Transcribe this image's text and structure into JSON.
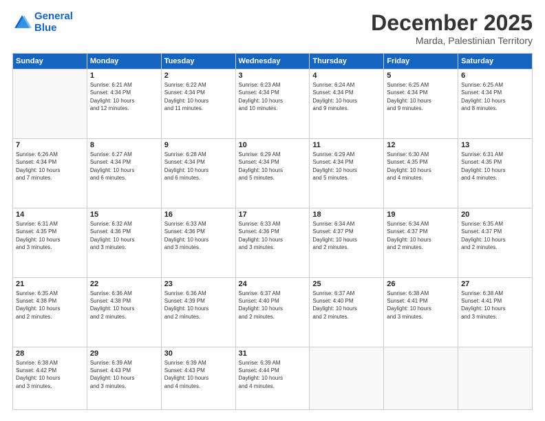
{
  "logo": {
    "line1": "General",
    "line2": "Blue"
  },
  "title": "December 2025",
  "location": "Marda, Palestinian Territory",
  "days_of_week": [
    "Sunday",
    "Monday",
    "Tuesday",
    "Wednesday",
    "Thursday",
    "Friday",
    "Saturday"
  ],
  "weeks": [
    [
      {
        "num": "",
        "info": ""
      },
      {
        "num": "1",
        "info": "Sunrise: 6:21 AM\nSunset: 4:34 PM\nDaylight: 10 hours\nand 12 minutes."
      },
      {
        "num": "2",
        "info": "Sunrise: 6:22 AM\nSunset: 4:34 PM\nDaylight: 10 hours\nand 11 minutes."
      },
      {
        "num": "3",
        "info": "Sunrise: 6:23 AM\nSunset: 4:34 PM\nDaylight: 10 hours\nand 10 minutes."
      },
      {
        "num": "4",
        "info": "Sunrise: 6:24 AM\nSunset: 4:34 PM\nDaylight: 10 hours\nand 9 minutes."
      },
      {
        "num": "5",
        "info": "Sunrise: 6:25 AM\nSunset: 4:34 PM\nDaylight: 10 hours\nand 9 minutes."
      },
      {
        "num": "6",
        "info": "Sunrise: 6:25 AM\nSunset: 4:34 PM\nDaylight: 10 hours\nand 8 minutes."
      }
    ],
    [
      {
        "num": "7",
        "info": "Sunrise: 6:26 AM\nSunset: 4:34 PM\nDaylight: 10 hours\nand 7 minutes."
      },
      {
        "num": "8",
        "info": "Sunrise: 6:27 AM\nSunset: 4:34 PM\nDaylight: 10 hours\nand 6 minutes."
      },
      {
        "num": "9",
        "info": "Sunrise: 6:28 AM\nSunset: 4:34 PM\nDaylight: 10 hours\nand 6 minutes."
      },
      {
        "num": "10",
        "info": "Sunrise: 6:29 AM\nSunset: 4:34 PM\nDaylight: 10 hours\nand 5 minutes."
      },
      {
        "num": "11",
        "info": "Sunrise: 6:29 AM\nSunset: 4:34 PM\nDaylight: 10 hours\nand 5 minutes."
      },
      {
        "num": "12",
        "info": "Sunrise: 6:30 AM\nSunset: 4:35 PM\nDaylight: 10 hours\nand 4 minutes."
      },
      {
        "num": "13",
        "info": "Sunrise: 6:31 AM\nSunset: 4:35 PM\nDaylight: 10 hours\nand 4 minutes."
      }
    ],
    [
      {
        "num": "14",
        "info": "Sunrise: 6:31 AM\nSunset: 4:35 PM\nDaylight: 10 hours\nand 3 minutes."
      },
      {
        "num": "15",
        "info": "Sunrise: 6:32 AM\nSunset: 4:36 PM\nDaylight: 10 hours\nand 3 minutes."
      },
      {
        "num": "16",
        "info": "Sunrise: 6:33 AM\nSunset: 4:36 PM\nDaylight: 10 hours\nand 3 minutes."
      },
      {
        "num": "17",
        "info": "Sunrise: 6:33 AM\nSunset: 4:36 PM\nDaylight: 10 hours\nand 3 minutes."
      },
      {
        "num": "18",
        "info": "Sunrise: 6:34 AM\nSunset: 4:37 PM\nDaylight: 10 hours\nand 2 minutes."
      },
      {
        "num": "19",
        "info": "Sunrise: 6:34 AM\nSunset: 4:37 PM\nDaylight: 10 hours\nand 2 minutes."
      },
      {
        "num": "20",
        "info": "Sunrise: 6:35 AM\nSunset: 4:37 PM\nDaylight: 10 hours\nand 2 minutes."
      }
    ],
    [
      {
        "num": "21",
        "info": "Sunrise: 6:35 AM\nSunset: 4:38 PM\nDaylight: 10 hours\nand 2 minutes."
      },
      {
        "num": "22",
        "info": "Sunrise: 6:36 AM\nSunset: 4:38 PM\nDaylight: 10 hours\nand 2 minutes."
      },
      {
        "num": "23",
        "info": "Sunrise: 6:36 AM\nSunset: 4:39 PM\nDaylight: 10 hours\nand 2 minutes."
      },
      {
        "num": "24",
        "info": "Sunrise: 6:37 AM\nSunset: 4:40 PM\nDaylight: 10 hours\nand 2 minutes."
      },
      {
        "num": "25",
        "info": "Sunrise: 6:37 AM\nSunset: 4:40 PM\nDaylight: 10 hours\nand 2 minutes."
      },
      {
        "num": "26",
        "info": "Sunrise: 6:38 AM\nSunset: 4:41 PM\nDaylight: 10 hours\nand 3 minutes."
      },
      {
        "num": "27",
        "info": "Sunrise: 6:38 AM\nSunset: 4:41 PM\nDaylight: 10 hours\nand 3 minutes."
      }
    ],
    [
      {
        "num": "28",
        "info": "Sunrise: 6:38 AM\nSunset: 4:42 PM\nDaylight: 10 hours\nand 3 minutes."
      },
      {
        "num": "29",
        "info": "Sunrise: 6:39 AM\nSunset: 4:43 PM\nDaylight: 10 hours\nand 3 minutes."
      },
      {
        "num": "30",
        "info": "Sunrise: 6:39 AM\nSunset: 4:43 PM\nDaylight: 10 hours\nand 4 minutes."
      },
      {
        "num": "31",
        "info": "Sunrise: 6:39 AM\nSunset: 4:44 PM\nDaylight: 10 hours\nand 4 minutes."
      },
      {
        "num": "",
        "info": ""
      },
      {
        "num": "",
        "info": ""
      },
      {
        "num": "",
        "info": ""
      }
    ]
  ]
}
